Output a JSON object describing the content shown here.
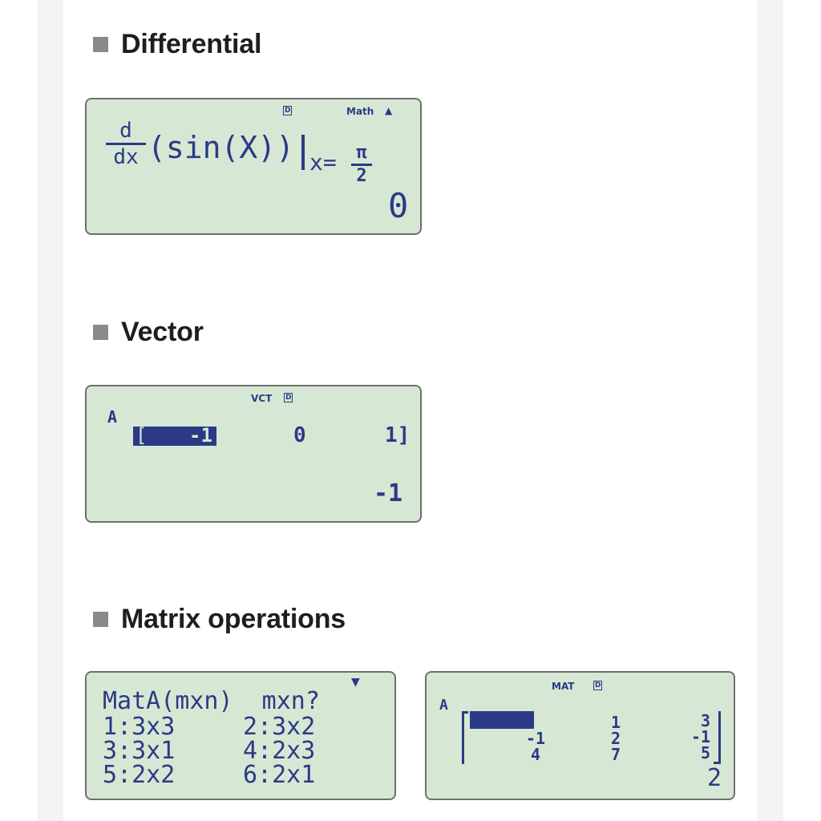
{
  "sections": {
    "differential": {
      "title": "Differential"
    },
    "vector": {
      "title": "Vector"
    },
    "matrix": {
      "title": "Matrix operations"
    }
  },
  "lcd_differential": {
    "indicator_d": "D",
    "indicator_mode": "Math",
    "indicator_arrow": "▲",
    "frac_num": "d",
    "frac_den": "dx",
    "expression": "(sin(X))",
    "eval_var": "x=",
    "pi_num": "π",
    "pi_den": "2",
    "result": "0"
  },
  "lcd_vector": {
    "indicator_mode": "VCT",
    "indicator_d": "D",
    "row_label": "A",
    "cell1_bracket": "[",
    "cell1_value": "-1",
    "cell2_value": "0",
    "cell3_value": "1]",
    "result": "-1"
  },
  "lcd_matrix_menu": {
    "arrow": "▼",
    "prompt": "MatA(mxn)  mxn?",
    "opt1": "1:3x3",
    "opt2": "2:3x2",
    "opt3": "3:3x1",
    "opt4": "4:2x3",
    "opt5": "5:2x2",
    "opt6": "6:2x1"
  },
  "lcd_matrix_result": {
    "indicator_mode": "MAT",
    "indicator_d": "D",
    "row_label": "A",
    "col1": [
      "",
      "-1",
      "4"
    ],
    "col2": [
      "1",
      "2",
      "7"
    ],
    "col3": [
      "3",
      "-1",
      "5"
    ],
    "result": "2"
  },
  "colors": {
    "lcd_bg": "#d6e8d4",
    "lcd_text": "#2b3a86",
    "bullet": "#8a8a8a",
    "title": "#1e1e1e"
  }
}
